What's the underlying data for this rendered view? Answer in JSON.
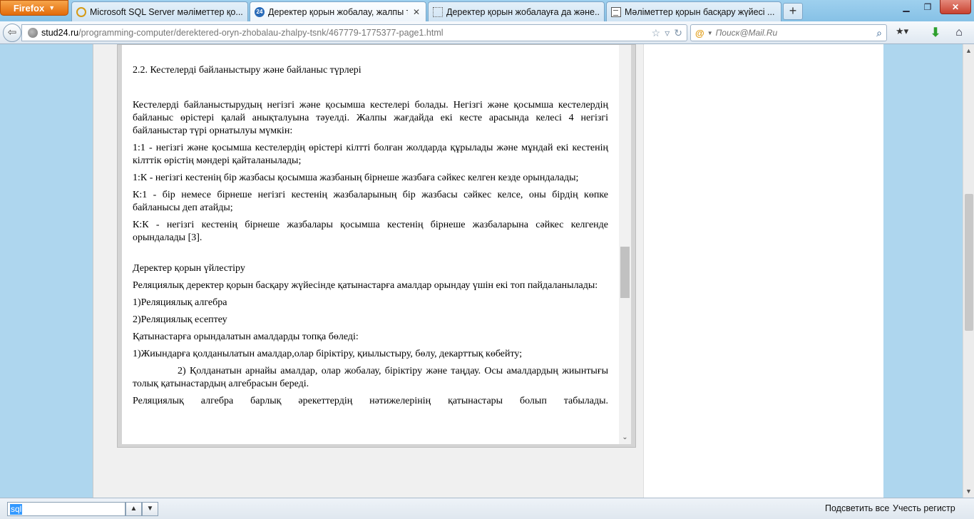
{
  "browser": {
    "app_button": "Firefox",
    "tabs": [
      {
        "title": "Microsoft SQL Server мәліметтер қо...",
        "icon": "search-favicon-icon"
      },
      {
        "title": "Деректер қорын жобалау, жалпы т...",
        "icon": "site-favicon-icon",
        "active": true
      },
      {
        "title": "Деректер қорын жобалауға да және...",
        "icon": "blank-page-icon"
      },
      {
        "title": "Мәліметтер қорын басқару жүйесі ...",
        "icon": "document-icon"
      }
    ],
    "favicon_text": "24",
    "new_tab": "+",
    "url_host": "stud24.ru",
    "url_path": "/programming-computer/derektered-oryn-zhobalau-zhalpy-tsnk/467779-1775377-page1.html",
    "search_placeholder": "Поиск@Mail.Ru"
  },
  "document": {
    "heading": "2.2. Кестелерді байланыстыру және байланыс түрлері",
    "paragraphs": [
      "Кестелерді байланыстырудың негізгі және қосымша кестелері болады. Негізгі және қосымша кестелердің байланыс өрістері қалай анықталуына тәуелді. Жалпы  жағдайда екі кесте арасында келесі 4 негізгі байланыстар түрі орнатылуы мүмкін:",
      "1:1 - негізгі және қосымша кестелердің өрістері кілтті болған жолдарда құрылады және мұндай екі кестенің кілттік өрістің мәндері қайталанылады;",
      "1:К - негізгі кестенің  бір жазбасы қосымша жазбаның  бірнеше жазбаға сәйкес келген кезде орындалады;",
      "К:1 - бір немесе бірнеше негізгі кестенің жазбаларының бір жазбасы сәйкес келсе, оны бірдің көпке байланысы деп атайды;",
      "К:К - негізгі кестенің бірнеше жазбалары қосымша кестенің бірнеше жазбаларына сәйкес келгенде орындалады [3]."
    ],
    "section_title": "Деректер қорын үйлестіру",
    "paragraphs2": [
      "Реляциялық деректер қорын басқару жүйесінде қатынастарға амалдар орындау үшін екі топ пайдаланылады:",
      "1)Реляциялық алгебра",
      "2)Реляциялық есептеу",
      "Қатынастарға орындалатын  амалдарды топқа бөледі:",
      "1)Жиындарға  қолданылатын амалдар,олар біріктіру, қиылыстыру, бөлу, декарттық  көбейту;",
      "2) Қолданатын арнайы амалдар, олар жобалау, біріктіру және таңдау. Осы амалдардың жиынтығы толық қатынастардың алгебрасын  береді.",
      "Реляциялық  алгебра   барлық  әрекеттердің  нәтижелерінің   қатынастары  болып  табылады."
    ]
  },
  "findbar": {
    "query": "sql",
    "highlight_all": "Подсветить все",
    "match_case": "Учесть регистр"
  }
}
